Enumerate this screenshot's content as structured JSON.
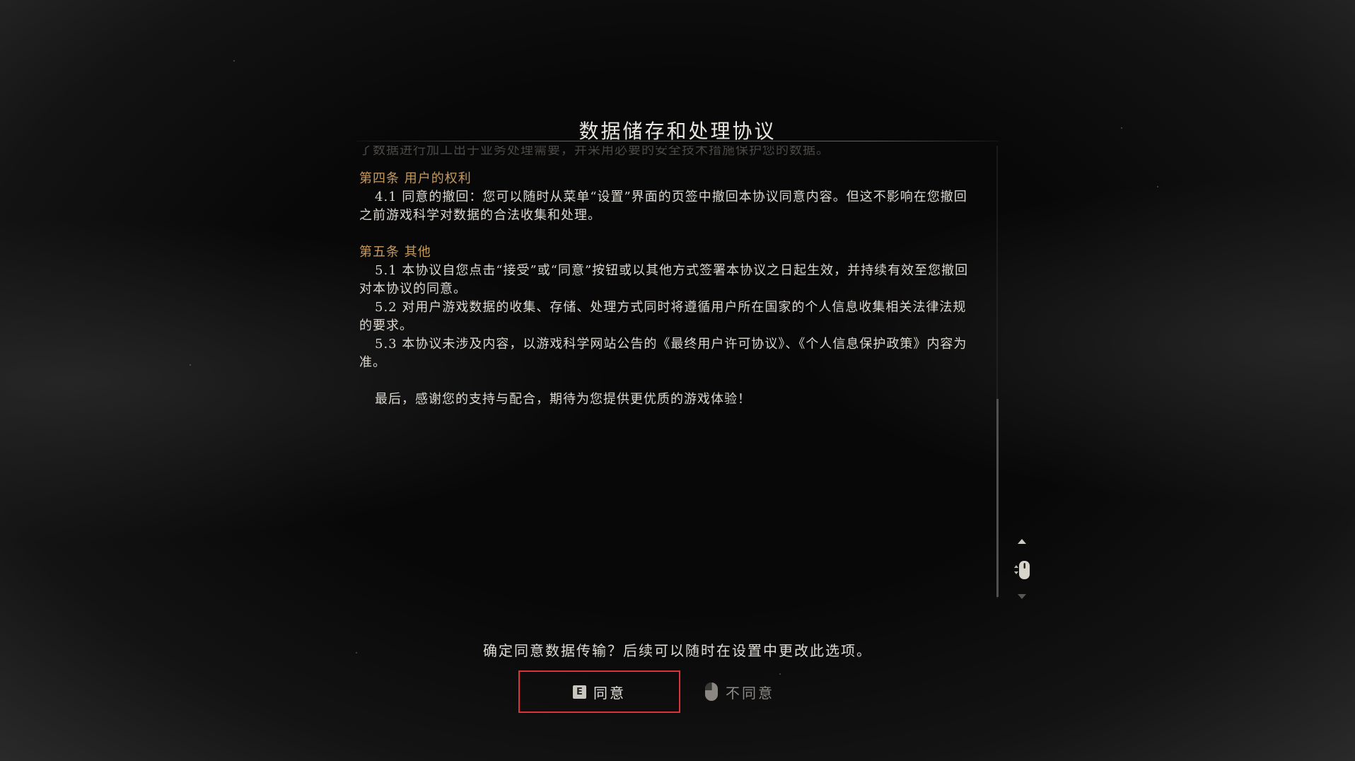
{
  "dialog": {
    "title": "数据储存和处理协议",
    "faded_line": "了数据进行加工出于业务处理需要，并采用必要的安全技术措施保护您的数据。",
    "sections": [
      {
        "heading": "第四条 用户的权利",
        "paragraphs": [
          "4.1 同意的撤回：您可以随时从菜单“设置”界面的页签中撤回本协议同意内容。但这不影响在您撤回之前游戏科学对数据的合法收集和处理。"
        ]
      },
      {
        "heading": "第五条 其他",
        "paragraphs": [
          "5.1 本协议自您点击“接受”或“同意”按钮或以其他方式签署本协议之日起生效，并持续有效至您撤回对本协议的同意。",
          "5.2 对用户游戏数据的收集、存储、处理方式同时将遵循用户所在国家的个人信息收集相关法律法规的要求。",
          "5.3 本协议未涉及内容，以游戏科学网站公告的《最终用户许可协议》、《个人信息保护政策》内容为准。"
        ]
      }
    ],
    "closing": "最后，感谢您的支持与配合，期待为您提供更优质的游戏体验！",
    "question": "确定同意数据传输？后续可以随时在设置中更改此选项。"
  },
  "buttons": {
    "agree_key": "E",
    "agree_label": "同意",
    "disagree_label": "不同意"
  },
  "icons": {
    "scroll_up": "chevron-up-icon",
    "scroll_down": "chevron-down-icon",
    "mouse_scroll": "mouse-scroll-icon",
    "mouse_right_click": "mouse-icon"
  },
  "colors": {
    "accent_border": "#d8343b",
    "section_heading": "#c59a60"
  }
}
